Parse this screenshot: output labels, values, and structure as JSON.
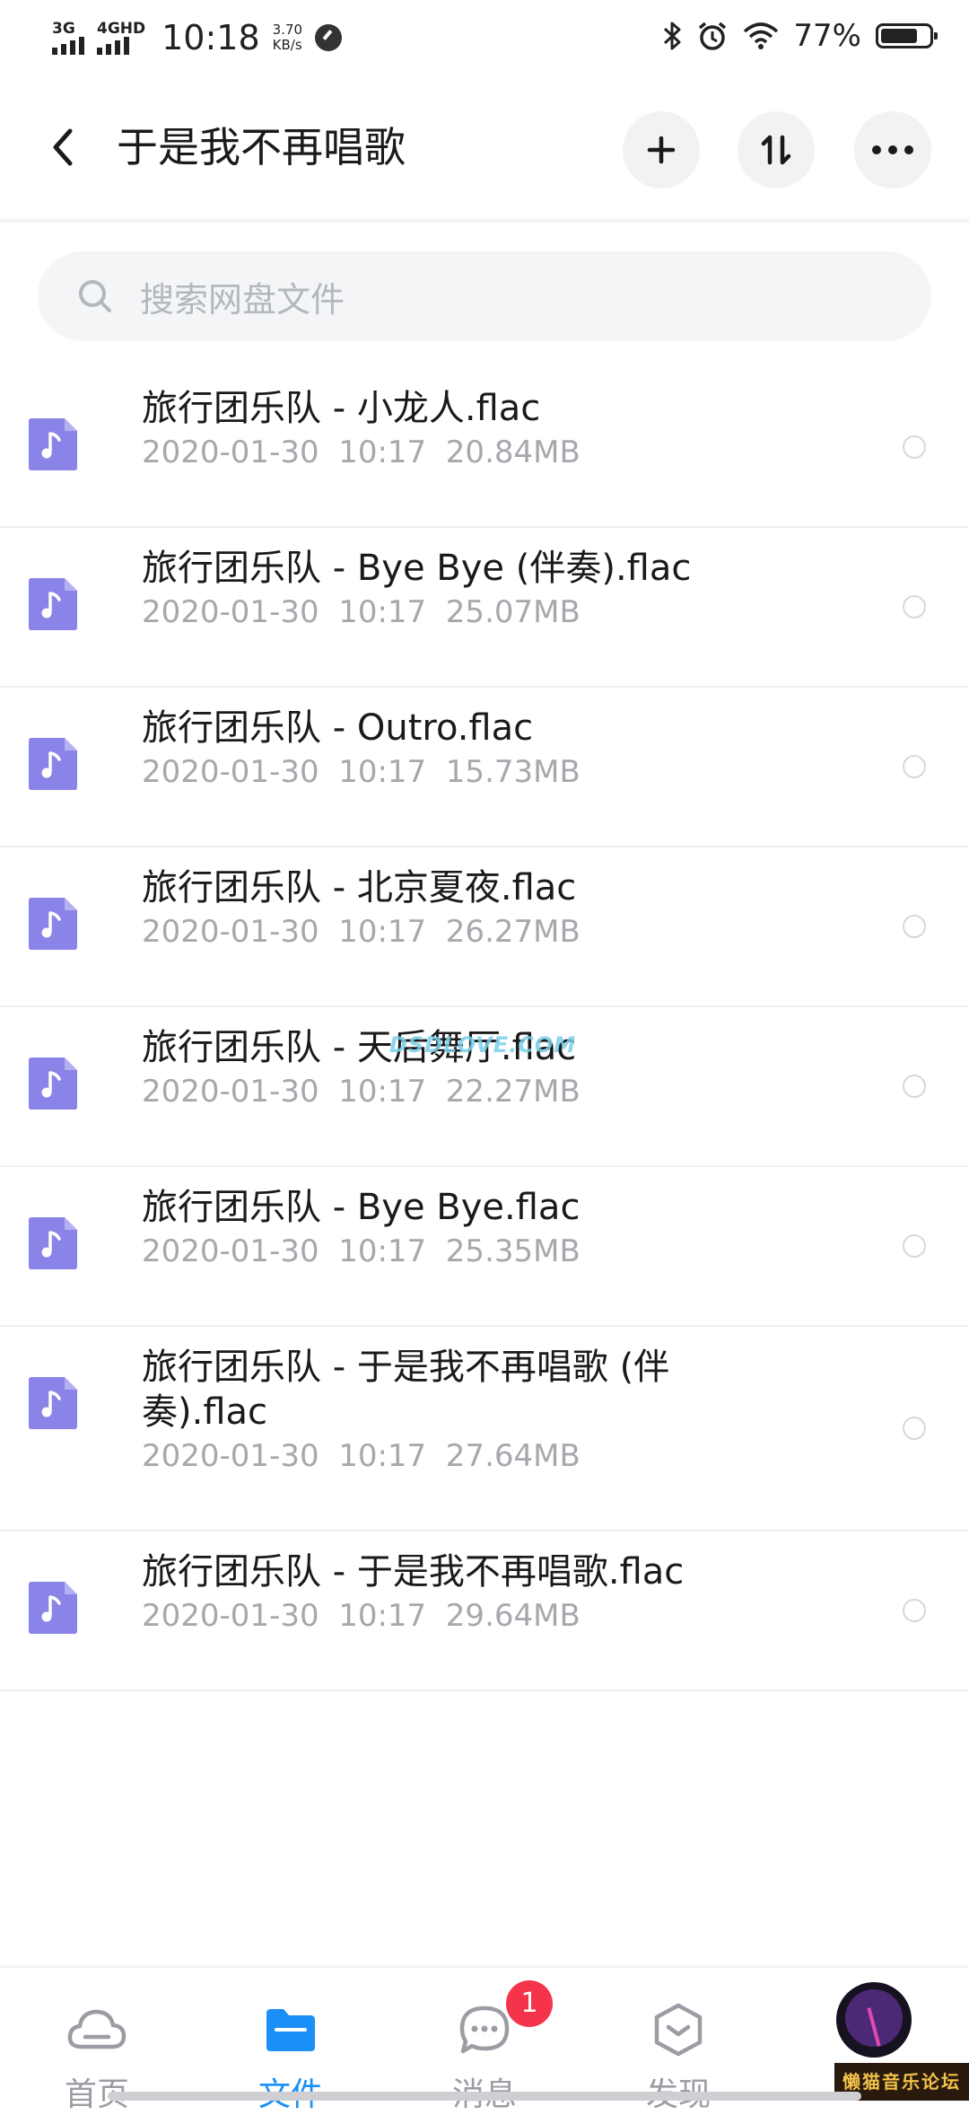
{
  "status_bar": {
    "network_left": "3G",
    "network_right": "4GHD",
    "time": "10:18",
    "speed_value": "3.70",
    "speed_unit": "KB/s",
    "battery_percent": "77%",
    "battery_level": 0.77
  },
  "header": {
    "title": "于是我不再唱歌",
    "back_icon": "chevron-left-icon",
    "add_icon": "plus-icon",
    "sort_icon": "sort-icon",
    "more_icon": "more-horizontal-icon"
  },
  "search": {
    "placeholder": "搜索网盘文件"
  },
  "files": [
    {
      "name": "旅行团乐队 - 小龙人.flac",
      "meta": "2020-01-30  10:17  20.84MB"
    },
    {
      "name": "旅行团乐队 - Bye Bye (伴奏).flac",
      "meta": "2020-01-30  10:17  25.07MB"
    },
    {
      "name": "旅行团乐队 - Outro.flac",
      "meta": "2020-01-30  10:17  15.73MB"
    },
    {
      "name": "旅行团乐队 - 北京夏夜.flac",
      "meta": "2020-01-30  10:17  26.27MB"
    },
    {
      "name": "旅行团乐队 - 天后舞厅.flac",
      "meta": "2020-01-30  10:17  22.27MB"
    },
    {
      "name": "旅行团乐队 - Bye Bye.flac",
      "meta": "2020-01-30  10:17  25.35MB"
    },
    {
      "name": "旅行团乐队 - 于是我不再唱歌 (伴奏).flac",
      "meta": "2020-01-30  10:17  27.64MB"
    },
    {
      "name": "旅行团乐队 - 于是我不再唱歌.flac",
      "meta": "2020-01-30  10:17  29.64MB"
    }
  ],
  "watermark": "DSDLOVE.COM",
  "bottom_nav": {
    "items": [
      {
        "label": "首页",
        "icon": "cloud-icon"
      },
      {
        "label": "文件",
        "icon": "folder-icon"
      },
      {
        "label": "消息",
        "icon": "chat-bubble-icon"
      },
      {
        "label": "发现",
        "icon": "discover-icon"
      }
    ],
    "active_index": 1,
    "messages_badge": "1",
    "profile_icon": "avatar"
  },
  "forum_mark": "懒猫音乐论坛",
  "colors": {
    "accent": "#1a8ff7",
    "file_icon": "#8a84e8",
    "badge": "#f5334a",
    "muted_text": "#a6a8ad"
  }
}
